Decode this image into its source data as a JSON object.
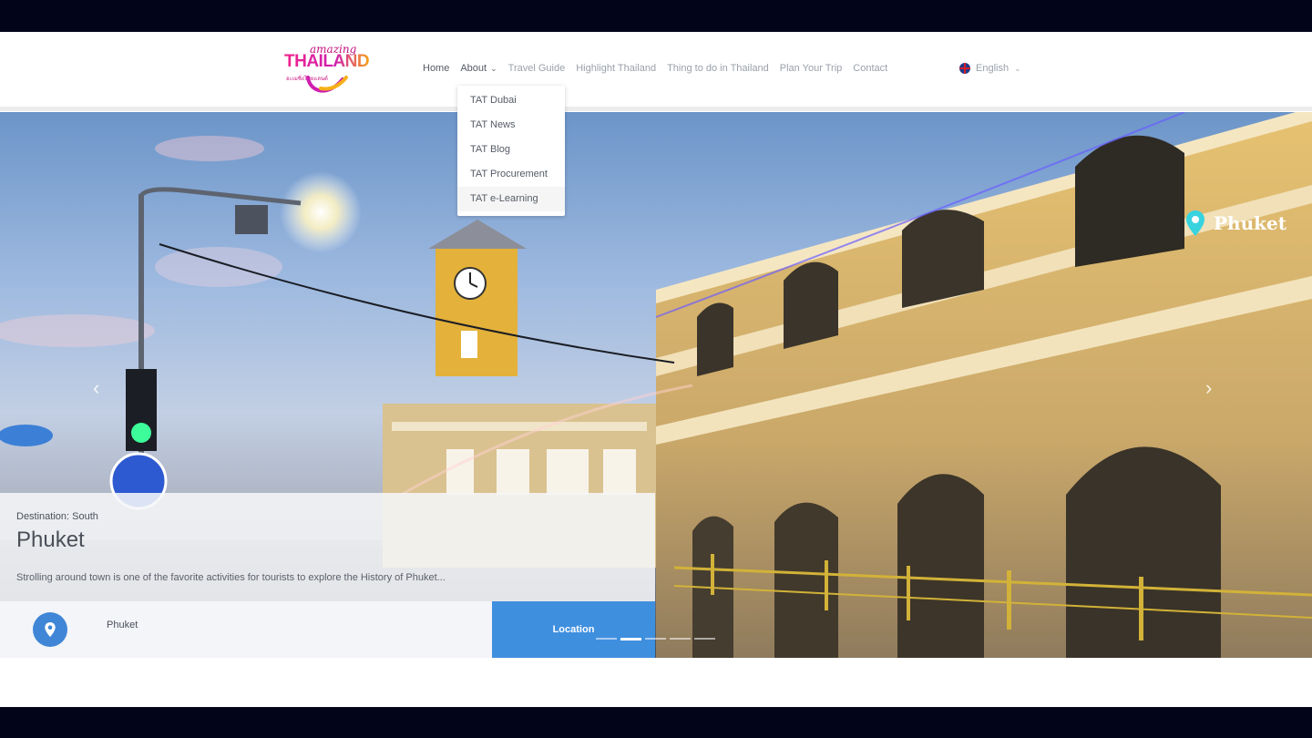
{
  "brand": {
    "logo_small": "amazing",
    "logo_big": "THAILAND",
    "logo_thai": "อะเมซิ่งไทยแลนด์"
  },
  "nav": {
    "items": [
      {
        "label": "Home"
      },
      {
        "label": "About"
      },
      {
        "label": "Travel Guide"
      },
      {
        "label": "Highlight Thailand"
      },
      {
        "label": "Thing to do in Thailand"
      },
      {
        "label": "Plan Your Trip"
      },
      {
        "label": "Contact"
      }
    ],
    "language": "English",
    "about_dropdown": [
      {
        "label": "TAT Dubai"
      },
      {
        "label": "TAT News"
      },
      {
        "label": "TAT Blog"
      },
      {
        "label": "TAT Procurement"
      },
      {
        "label": "TAT e-Learning"
      }
    ]
  },
  "hero": {
    "pin_label": "Phuket",
    "prev_arrow": "‹",
    "next_arrow": "›",
    "destination": "Destination: South",
    "title": "Phuket",
    "description": "Strolling around town is one of the favorite activities for tourists to explore the History of Phuket...",
    "location_name": "Phuket",
    "location_button": "Location",
    "slide_count": 5,
    "active_slide": 2
  },
  "colors": {
    "accent_blue": "#3f8fdf",
    "brand_pink": "#c6117e",
    "pin_teal": "#39d3e0"
  }
}
